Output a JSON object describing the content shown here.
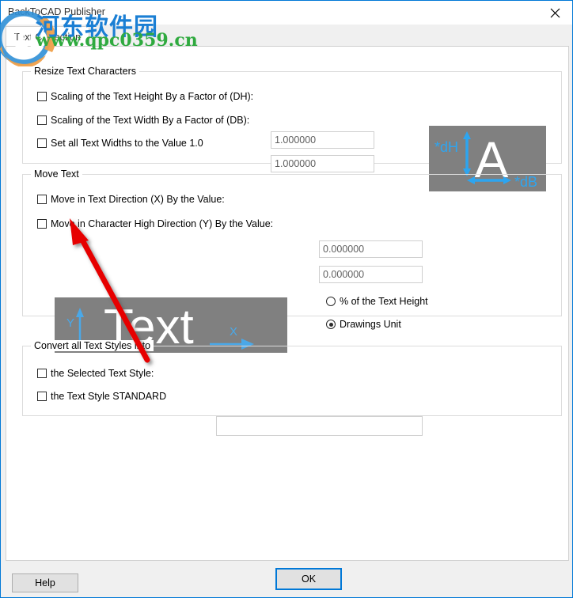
{
  "window": {
    "title": "BackToCAD Publisher",
    "close_icon": "close-icon"
  },
  "tabs": [
    {
      "label": "Text Correction",
      "active": true
    }
  ],
  "groups": {
    "resize": {
      "title": "Resize Text Characters",
      "checkboxes": [
        {
          "label": "Scaling of the Text Height By a Factor of (DH):",
          "checked": false
        },
        {
          "label": "Scaling of the Text Width By a Factor of (DB):",
          "checked": false
        },
        {
          "label": "Set all Text Widths to the Value 1.0",
          "checked": false
        }
      ],
      "inputs": [
        {
          "value": "1.000000"
        },
        {
          "value": "1.000000"
        }
      ],
      "illustration": {
        "name": "text-height-width-diagram",
        "letter": "A",
        "label_height": "*dH",
        "label_width": "*dB",
        "bg_color": "#808080",
        "accent_color": "#2da5f0",
        "letter_color": "#ffffff"
      }
    },
    "move": {
      "title": "Move Text",
      "checkboxes": [
        {
          "label": "Move in Text Direction (X) By the Value:",
          "checked": false
        },
        {
          "label": "Move in Character High Direction (Y) By the Value:",
          "checked": false
        }
      ],
      "inputs": [
        {
          "value": "0.000000"
        },
        {
          "value": "0.000000"
        }
      ],
      "radios": [
        {
          "label": "% of the Text Height",
          "checked": false
        },
        {
          "label": "Drawings Unit",
          "checked": true
        }
      ],
      "illustration": {
        "name": "text-xy-direction-diagram",
        "word": "Text",
        "label_y": "Y",
        "label_x": "X",
        "bg_color": "#808080",
        "accent_color": "#2da5f0",
        "text_color": "#ffffff"
      }
    },
    "convert": {
      "title": "Convert all Text Styles into",
      "checkboxes": [
        {
          "label": "the Selected Text Style:",
          "checked": false
        },
        {
          "label": "the Text Style STANDARD",
          "checked": false
        }
      ],
      "inputs": [
        {
          "value": ""
        }
      ]
    }
  },
  "footer": {
    "help_label": "Help",
    "ok_label": "OK",
    "focus_color": "#0078d7"
  },
  "watermark": {
    "site_name": "河东软件园",
    "site_url": "www.qpc0359.cn",
    "site_name_color": "#1b7fd4",
    "site_url_color": "#2faa3f",
    "logo_icon": "circle-logo-icon"
  },
  "annotation": {
    "arrow_color": "#e60000",
    "arrow_name": "red-pointer-arrow"
  }
}
